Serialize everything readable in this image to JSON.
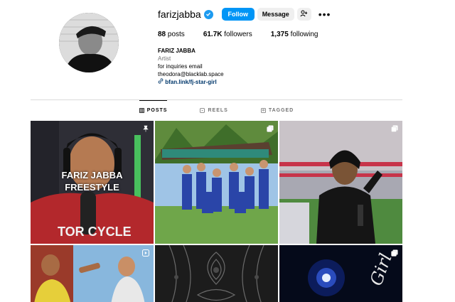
{
  "profile": {
    "username": "farizjabba",
    "follow_label": "Follow",
    "message_label": "Message",
    "more_label": "•••"
  },
  "stats": {
    "posts_count": "88",
    "posts_label": "posts",
    "followers_count": "61.7K",
    "followers_label": "followers",
    "following_count": "1,375",
    "following_label": "following"
  },
  "bio": {
    "name": "FARIZ JABBA",
    "category": "Artist",
    "line1": "for inquiries email",
    "line2": "theodora@blacklab.space",
    "link": "bfan.link/fj-star-girl"
  },
  "tabs": [
    {
      "label": "POSTS",
      "icon": "grid-icon",
      "active": true
    },
    {
      "label": "REELS",
      "icon": "reels-icon",
      "active": false
    },
    {
      "label": "TAGGED",
      "icon": "tagged-icon",
      "active": false
    }
  ],
  "posts": [
    {
      "caption": "FARIZ JABBA FREESTYLE",
      "badge": "pin-icon",
      "shirt_text": "TOR CYCLE"
    },
    {
      "caption": "",
      "badge": "carousel-icon"
    },
    {
      "caption": "",
      "badge": "carousel-icon"
    },
    {
      "caption": "",
      "badge": "reel-icon"
    },
    {
      "caption": "",
      "badge": ""
    },
    {
      "caption": "",
      "badge": "carousel-icon",
      "art_text": "Girl"
    }
  ],
  "colors": {
    "accent": "#0095f6",
    "verified": "#1d9bf0",
    "link": "#00376b",
    "muted": "#737373",
    "divider": "#dbdbdb"
  }
}
